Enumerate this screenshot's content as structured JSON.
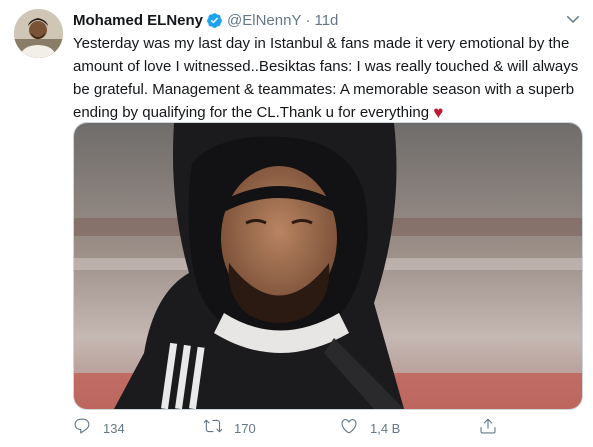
{
  "tweet": {
    "author_name": "Mohamed ELNeny",
    "handle": "@ElNennY",
    "separator": "·",
    "time": "11d",
    "text_main": "Yesterday was my last day in Istanbul & fans made it very emotional by the amount of love I witnessed..Besiktas fans: I was really touched & will always be grateful. Management & teammates: A memorable season with a superb ending by qualifying for the CL.Thank u for everything",
    "emoji": "♥"
  },
  "actions": {
    "replies": "134",
    "retweets": "170",
    "likes": "1,4 B"
  },
  "icons": {
    "verified": "verified-badge-icon",
    "caret": "chevron-down-icon",
    "reply": "reply-icon",
    "retweet": "retweet-icon",
    "like": "heart-icon",
    "share": "share-icon"
  },
  "colors": {
    "text": "#14171a",
    "secondary": "#657786",
    "verified": "#1da1f2",
    "heart": "#be1931",
    "border": "#ccd6dd"
  }
}
